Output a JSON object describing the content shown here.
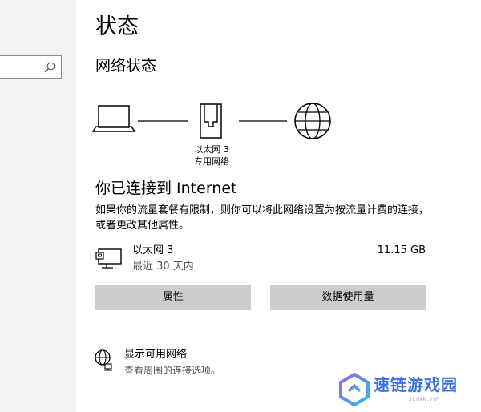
{
  "search": {
    "value": ""
  },
  "page": {
    "title": "状态"
  },
  "network_status": {
    "section_title": "网络状态",
    "adapter_name": "以太网 3",
    "adapter_type": "专用网络"
  },
  "connection": {
    "heading": "你已连接到 Internet",
    "description": "如果你的流量套餐有限制，则你可以将此网络设置为按流量计费的连接，或者更改其他属性。",
    "name": "以太网 3",
    "period": "最近 30 天内",
    "usage": "11.15 GB"
  },
  "buttons": {
    "properties": "属性",
    "data_usage": "数据使用量"
  },
  "show_networks": {
    "title": "显示可用网络",
    "subtitle": "查看周围的连接选项。"
  },
  "watermark": {
    "text": "速链游戏园",
    "sub": "SLINK.VIP"
  },
  "colors": {
    "sidebar_bg": "#f2f2f2",
    "button_bg": "#cccccc",
    "watermark": "#3b6fe0"
  },
  "icons": {
    "search": "search-icon",
    "laptop": "laptop-icon",
    "ethernet": "ethernet-icon",
    "globe": "globe-icon",
    "connection": "ethernet-pc-icon",
    "network_globe": "globe-network-icon"
  }
}
